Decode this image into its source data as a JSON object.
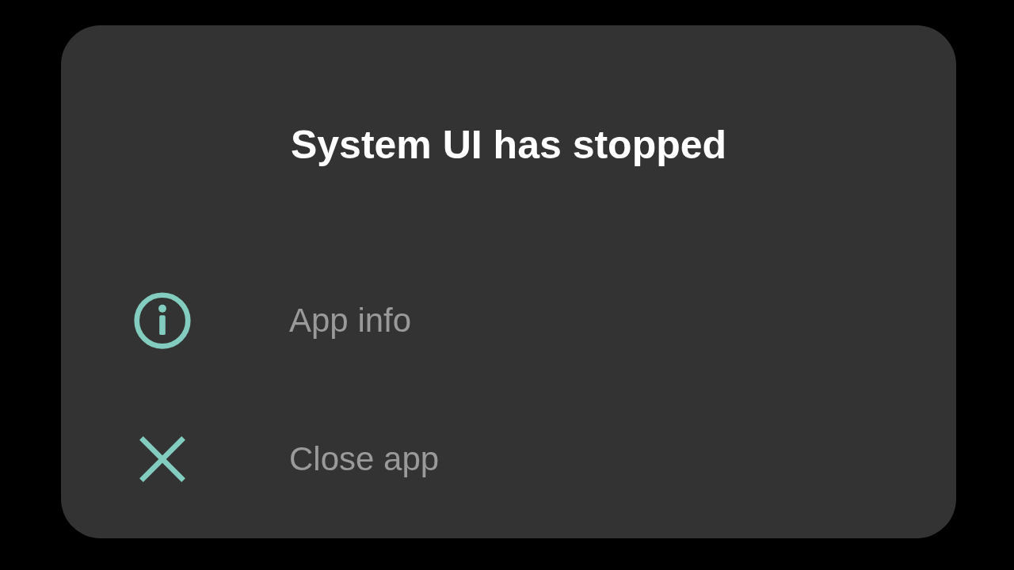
{
  "dialog": {
    "title": "System UI has stopped",
    "options": [
      {
        "kind": "info",
        "label": "App info"
      },
      {
        "kind": "close",
        "label": "Close app"
      }
    ]
  }
}
